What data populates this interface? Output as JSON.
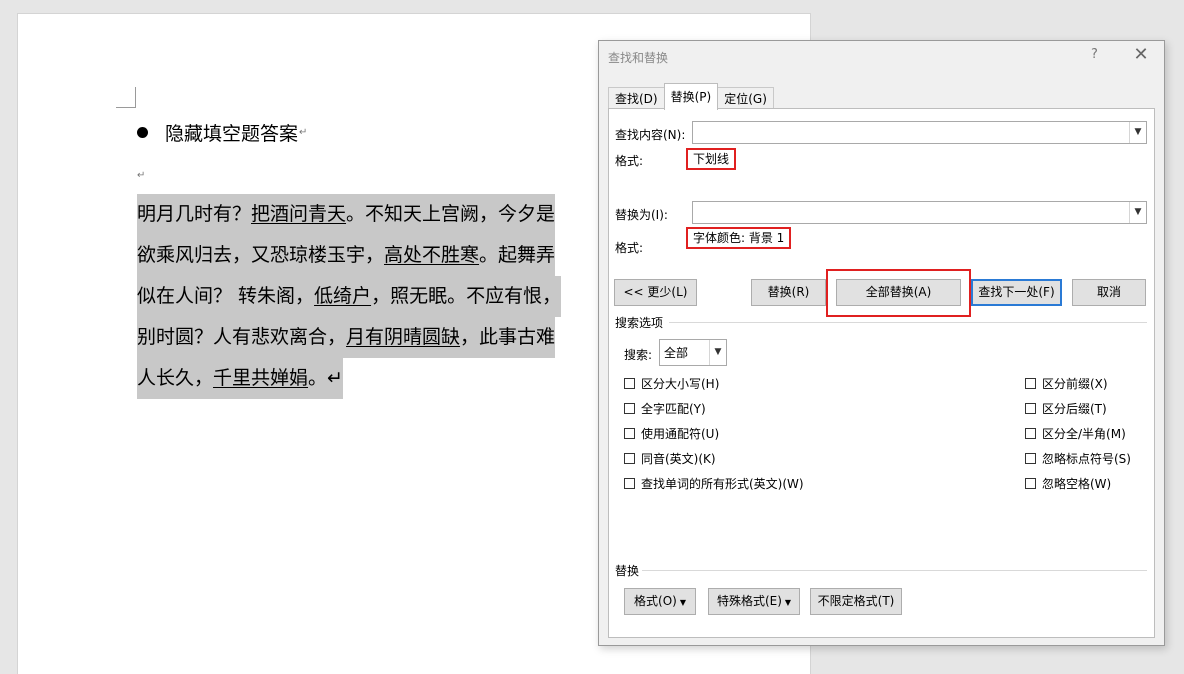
{
  "document": {
    "bullet_text": "隐藏填空题答案",
    "para_mark": "↵",
    "poem_lines": [
      [
        {
          "t": "明月几时有？"
        },
        {
          "t": "把酒问青天",
          "u": true
        },
        {
          "t": "。不知天上宫阙，今夕是"
        }
      ],
      [
        {
          "t": "欲乘风归去，又恐琼楼玉宇，"
        },
        {
          "t": "高处不胜寒",
          "u": true
        },
        {
          "t": "。起舞弄"
        }
      ],
      [
        {
          "t": "似在人间？ 转朱阁，"
        },
        {
          "t": "低绮户",
          "u": true
        },
        {
          "t": "，照无眠。不应有恨，"
        }
      ],
      [
        {
          "t": "别时圆？人有悲欢离合，"
        },
        {
          "t": "月有阴晴圆缺",
          "u": true
        },
        {
          "t": "，此事古难"
        }
      ],
      [
        {
          "t": "人长久，"
        },
        {
          "t": "千里共婵娟",
          "u": true
        },
        {
          "t": "。↵"
        }
      ]
    ]
  },
  "dialog": {
    "title": "查找和替换",
    "help": "?",
    "close": "✕",
    "tabs": [
      "查找(D)",
      "替换(P)",
      "定位(G)"
    ],
    "active_tab": "替换(P)",
    "find_label": "查找内容(N):",
    "find_value": "",
    "find_format_label": "格式:",
    "find_format_value": "下划线",
    "replace_label": "替换为(I):",
    "replace_value": "",
    "replace_format_label": "格式:",
    "replace_format_value": "字体颜色: 背景 1",
    "buttons": {
      "less": "<< 更少(L)",
      "replace": "替换(R)",
      "replace_all": "全部替换(A)",
      "find_next": "查找下一处(F)",
      "cancel": "取消"
    },
    "search_options_title": "搜索选项",
    "search_label": "搜索:",
    "search_value": "全部",
    "left_options": [
      "区分大小写(H)",
      "全字匹配(Y)",
      "使用通配符(U)",
      "同音(英文)(K)",
      "查找单词的所有形式(英文)(W)"
    ],
    "right_options": [
      "区分前缀(X)",
      "区分后缀(T)",
      "区分全/半角(M)",
      "忽略标点符号(S)",
      "忽略空格(W)"
    ],
    "replace_section_title": "替换",
    "bottom_buttons": {
      "format": "格式(O)",
      "special": "特殊格式(E)",
      "no_format": "不限定格式(T)"
    },
    "accent_color": "#2a7ad5",
    "highlight_color": "#e02020"
  }
}
